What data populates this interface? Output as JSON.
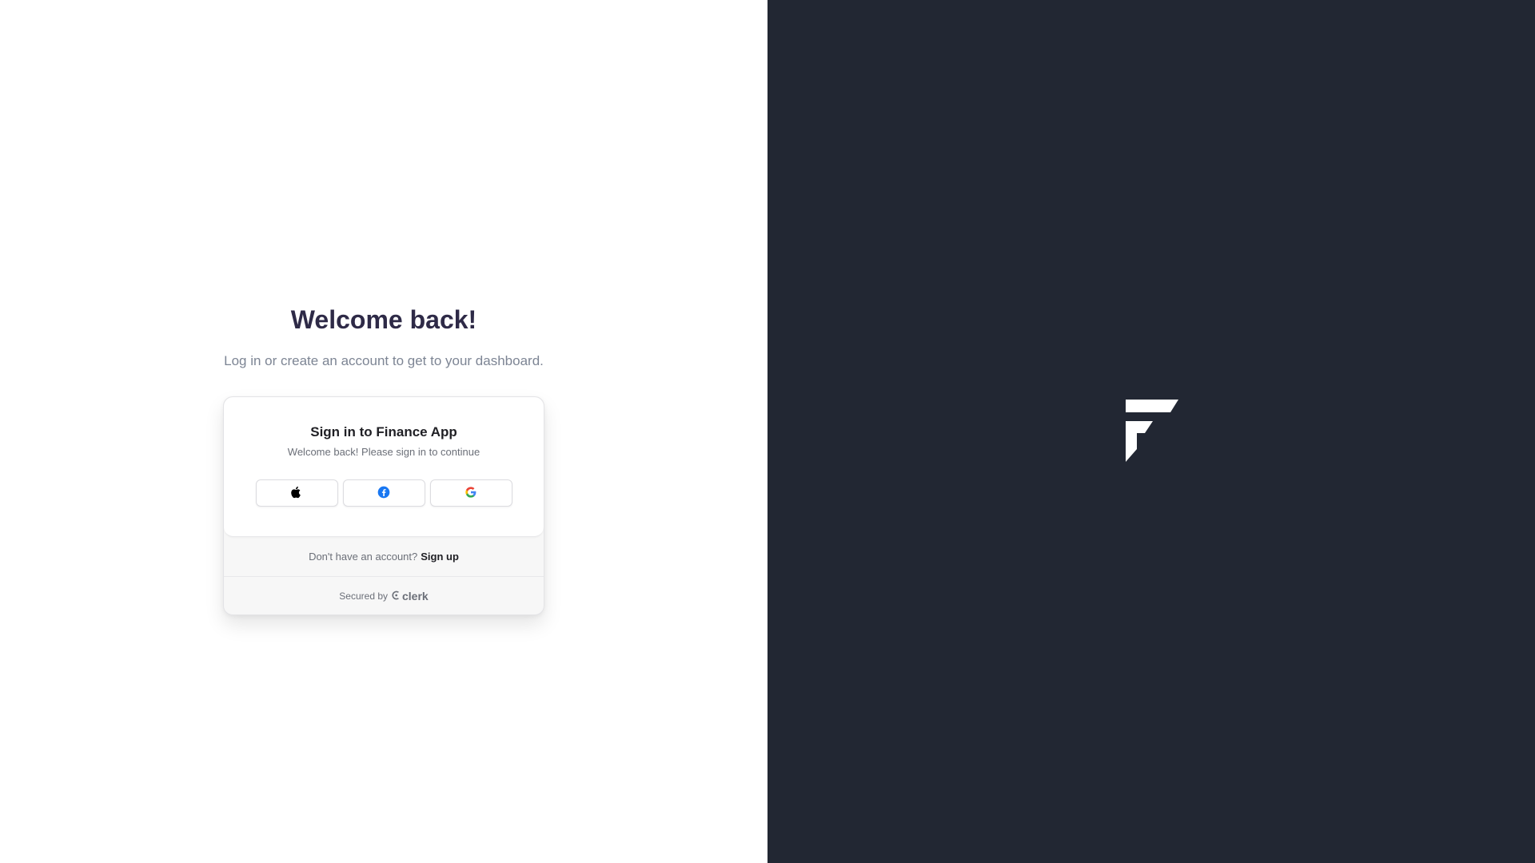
{
  "auth_page": {
    "heading": "Welcome back!",
    "subheading": "Log in or create an account to get to your dashboard."
  },
  "signin_card": {
    "title": "Sign in to Finance App",
    "subtitle": "Welcome back! Please sign in to continue",
    "social_buttons": [
      {
        "provider": "apple",
        "icon": "apple-icon"
      },
      {
        "provider": "facebook",
        "icon": "facebook-icon",
        "color": "#1877F2"
      },
      {
        "provider": "google",
        "icon": "google-icon"
      }
    ],
    "footer": {
      "signup_prompt": "Don't have an account?",
      "signup_link": "Sign up",
      "secured_by": "Secured by",
      "brand": "clerk"
    }
  },
  "brand_panel": {
    "background": "#222733",
    "logo": "finance-logo-icon"
  }
}
